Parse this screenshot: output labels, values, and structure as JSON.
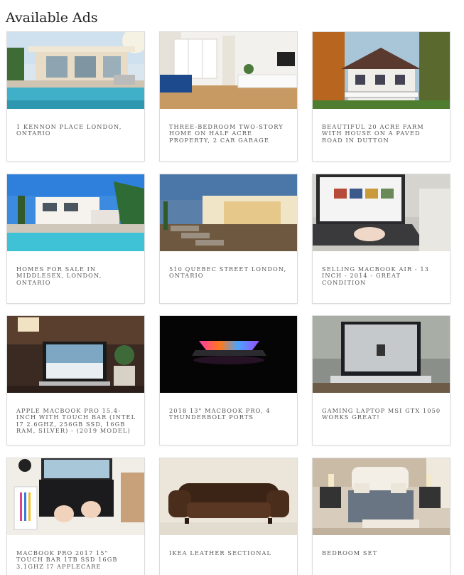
{
  "page": {
    "heading": "Available Ads"
  },
  "ads": [
    {
      "title": "1 Kennon Place London, Ontario"
    },
    {
      "title": "Three-bedroom two-story home on half acre property, 2 car garage"
    },
    {
      "title": "Beautiful 20 acre farm with house on a paved road in Dutton"
    },
    {
      "title": "Homes for sale in Middlesex, London, Ontario"
    },
    {
      "title": "510 Quebec Street London, Ontario"
    },
    {
      "title": "Selling MacBook Air - 13 inch - 2014 - Great Condition"
    },
    {
      "title": "Apple MacBook Pro 15.4-inch with Touch Bar (Intel i7 2.6GHz, 256GB SSD, 16GB RAM, Silver) - (2019 Model)"
    },
    {
      "title": "2018 13\" MacBook Pro, 4 Thunderbolt ports"
    },
    {
      "title": "Gaming Laptop MSI GTX 1050 works great!"
    },
    {
      "title": "Macbook pro 2017 15\" Touch Bar 1TB SSD 16GB 3.1GHz i7 AppleCare"
    },
    {
      "title": "Ikea Leather Sectional"
    },
    {
      "title": "Bedroom Set"
    }
  ]
}
